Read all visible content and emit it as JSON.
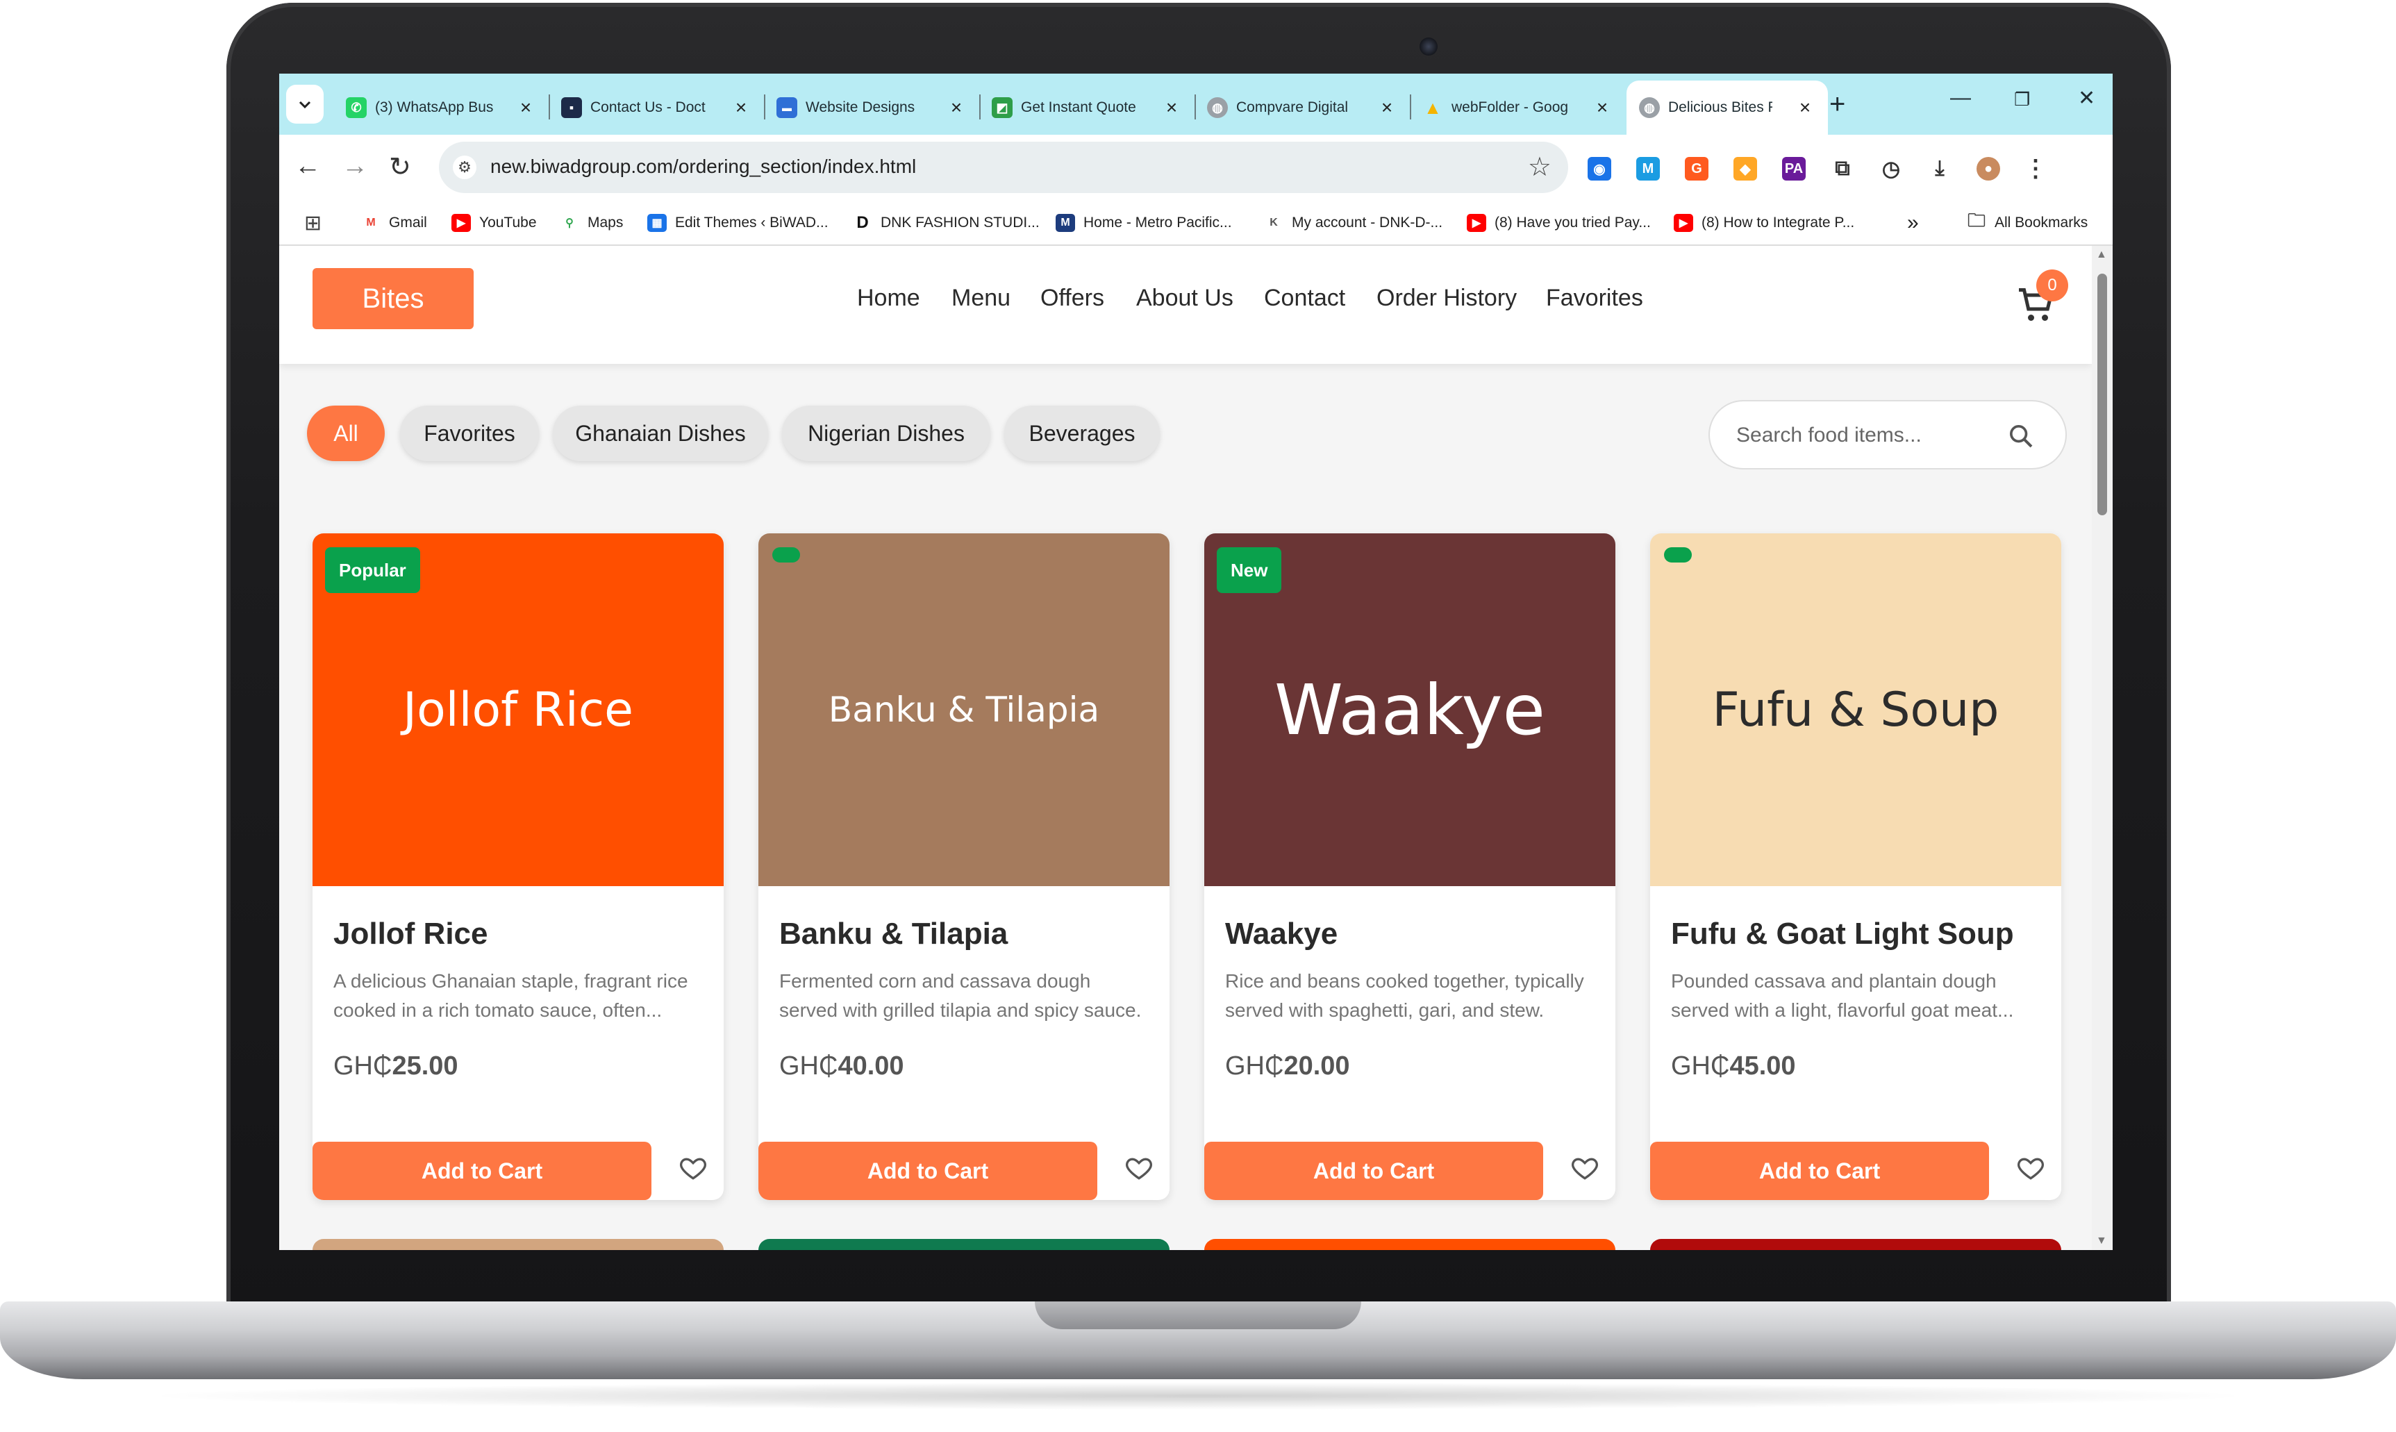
{
  "browser": {
    "tabs": [
      {
        "label": "(3) WhatsApp Bus",
        "icon": "whatsapp-icon",
        "color": "#25d366",
        "glyph": "✆"
      },
      {
        "label": "Contact Us - Doct",
        "icon": "site-icon",
        "color": "#1c2a48",
        "glyph": "▪"
      },
      {
        "label": "Website Designs",
        "icon": "site-icon",
        "color": "#2f6fd6",
        "glyph": "▬"
      },
      {
        "label": "Get Instant Quote",
        "icon": "site-icon",
        "color": "#2e9e49",
        "glyph": "◩"
      },
      {
        "label": "Compvare Digital",
        "icon": "globe-icon",
        "color": "#9aa0a6",
        "glyph": "◍"
      },
      {
        "label": "webFolder - Goog",
        "icon": "drive-icon",
        "color": "#f4b400",
        "glyph": "▲"
      },
      {
        "label": "Delicious Bites Fo",
        "icon": "globe-icon",
        "color": "#9aa0a6",
        "glyph": "◍"
      }
    ],
    "new_tab": "+",
    "url": "new.biwadgroup.com/ordering_section/index.html",
    "bookmarks": [
      {
        "label": "Gmail",
        "color": "#ea4335",
        "glyph": "M"
      },
      {
        "label": "YouTube",
        "color": "#ff0000",
        "glyph": "▶"
      },
      {
        "label": "Maps",
        "color": "#34a853",
        "glyph": "⚲"
      },
      {
        "label": "Edit Themes ‹ BiWAD...",
        "color": "#1a73e8",
        "glyph": "▦"
      },
      {
        "label": "DNK FASHION STUDI...",
        "color": "#111111",
        "glyph": "D"
      },
      {
        "label": "Home - Metro Pacific...",
        "color": "#1d3c7d",
        "glyph": "M"
      },
      {
        "label": "My account - DNK-D-...",
        "color": "#555555",
        "glyph": "K"
      },
      {
        "label": "(8) Have you tried Pay...",
        "color": "#ff0000",
        "glyph": "▶"
      },
      {
        "label": "(8) How to Integrate P...",
        "color": "#ff0000",
        "glyph": "▶"
      }
    ],
    "bookmarks_more": "»",
    "all_bookmarks": "All Bookmarks"
  },
  "site": {
    "logo": "Bites",
    "nav": [
      "Home",
      "Menu",
      "Offers",
      "About Us",
      "Contact",
      "Order History",
      "Favorites"
    ],
    "cart_count": "0",
    "filters": [
      "All",
      "Favorites",
      "Ghanaian Dishes",
      "Nigerian Dishes",
      "Beverages"
    ],
    "active_filter": "All",
    "search_placeholder": "Search food items...",
    "accent_color": "#fe7743"
  },
  "products": [
    {
      "image_text": "Jollof Rice",
      "image_bg": "#ff4f00",
      "image_fg": "#ffffff",
      "badge": "Popular",
      "title": "Jollof Rice",
      "desc1": "A delicious Ghanaian staple, fragrant rice",
      "desc2": "cooked in a rich tomato sauce, often...",
      "currency": "GH₵",
      "price": "25.00",
      "button": "Add to Cart"
    },
    {
      "image_text": "Banku & Tilapia",
      "image_bg": "#a57b5d",
      "image_fg": "#ffffff",
      "badge": "",
      "title": "Banku & Tilapia",
      "desc1": "Fermented corn and cassava dough",
      "desc2": "served with grilled tilapia and spicy sauce.",
      "currency": "GH₵",
      "price": "40.00",
      "button": "Add to Cart"
    },
    {
      "image_text": "Waakye",
      "image_bg": "#6a3535",
      "image_fg": "#ffffff",
      "badge": "New",
      "title": "Waakye",
      "desc1": "Rice and beans cooked together, typically",
      "desc2": "served with spaghetti, gari, and stew.",
      "currency": "GH₵",
      "price": "20.00",
      "button": "Add to Cart"
    },
    {
      "image_text": "Fufu & Soup",
      "image_bg": "#f7dcb2",
      "image_fg": "#2c2c2c",
      "badge": "",
      "title": "Fufu & Goat Light Soup",
      "desc1": "Pounded cassava and plantain dough",
      "desc2": "served with a light, flavorful goat meat...",
      "currency": "GH₵",
      "price": "45.00",
      "button": "Add to Cart"
    }
  ],
  "next_row_colors": [
    "#d2a57f",
    "#0f7a4f",
    "#ff4f00",
    "#b10b0b"
  ]
}
